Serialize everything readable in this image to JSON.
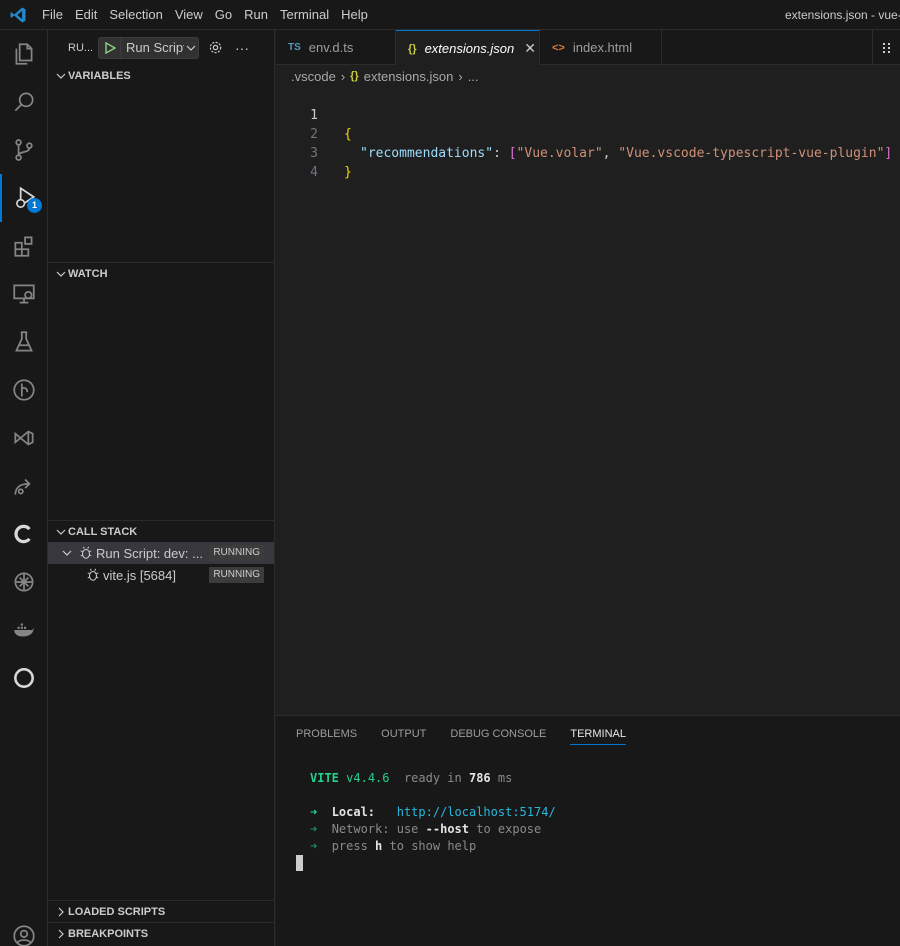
{
  "titlebar": {
    "menu": [
      "File",
      "Edit",
      "Selection",
      "View",
      "Go",
      "Run",
      "Terminal",
      "Help"
    ],
    "window_title": "extensions.json - vue-"
  },
  "activity": {
    "debug_badge": "1"
  },
  "sidebar": {
    "title": "RU...",
    "run_config": "Run Script:",
    "sections": {
      "variables": "VARIABLES",
      "watch": "WATCH",
      "call_stack": "CALL STACK",
      "loaded_scripts": "LOADED SCRIPTS",
      "breakpoints": "BREAKPOINTS"
    },
    "call_stack": [
      {
        "label": "Run Script: dev: ...",
        "status": "RUNNING"
      },
      {
        "label": "vite.js [5684]",
        "status": "RUNNING"
      }
    ]
  },
  "tabs": [
    {
      "icon": "TS",
      "label": "env.d.ts"
    },
    {
      "icon": "{}",
      "label": "extensions.json"
    },
    {
      "icon": "<>",
      "label": "index.html"
    }
  ],
  "breadcrumb": [
    ".vscode",
    "extensions.json",
    "..."
  ],
  "editor": {
    "line_numbers": [
      "1",
      "2",
      "3",
      "4"
    ],
    "open_brace": "{",
    "key": "\"recommendations\"",
    "colon": ": ",
    "open_bracket": "[",
    "str1": "\"Vue.volar\"",
    "comma": ", ",
    "str2": "\"Vue.vscode-typescript-vue-plugin\"",
    "close_bracket": "]",
    "close_brace": "}"
  },
  "panel": {
    "tabs": [
      "PROBLEMS",
      "OUTPUT",
      "DEBUG CONSOLE",
      "TERMINAL"
    ],
    "terminal": {
      "vite": "VITE",
      "version": "v4.4.6",
      "ready": "ready in",
      "ms_value": "786",
      "ms": "ms",
      "arrow": "➜",
      "local_label": "Local:",
      "local_url": "http://localhost:5174/",
      "network_label": "Network:",
      "network_use": "use",
      "network_flag": "--host",
      "network_rest": "to expose",
      "press": "press",
      "press_key": "h",
      "press_rest": "to show help"
    }
  },
  "colors": {
    "accent": "#0078d4",
    "background": "#1f1f1f",
    "sidebar": "#181818"
  }
}
